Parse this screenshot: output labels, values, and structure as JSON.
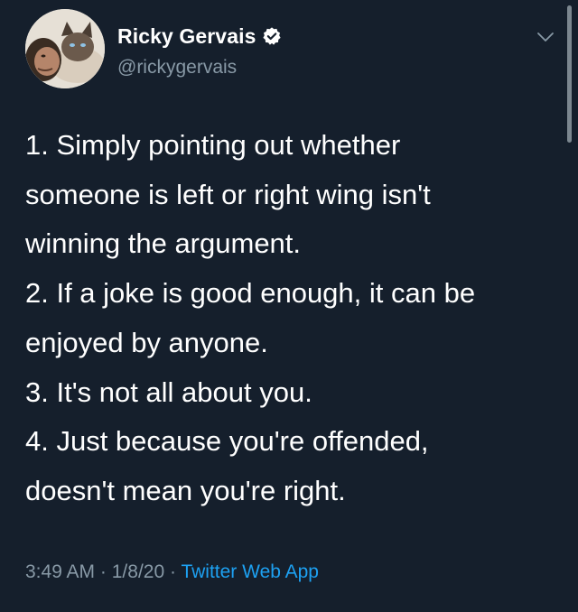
{
  "author": {
    "display_name": "Ricky Gervais",
    "handle": "@rickygervais",
    "verified_icon": "verified-badge-icon"
  },
  "tweet": {
    "lines": [
      "1. Simply pointing out whether",
      "someone is left or right wing isn't",
      "winning the argument.",
      "2. If a joke is good enough, it can be",
      "enjoyed by anyone.",
      "3. It's not all about you.",
      "4. Just because you're offended,",
      "doesn't mean you're right."
    ]
  },
  "meta": {
    "time": "3:49 AM",
    "separator": "·",
    "date": "1/8/20",
    "source": "Twitter Web App"
  },
  "icons": {
    "menu": "chevron-down-icon"
  },
  "colors": {
    "background": "#151f2c",
    "text": "#ffffff",
    "secondary": "#8899a6",
    "link": "#1da1f2"
  }
}
